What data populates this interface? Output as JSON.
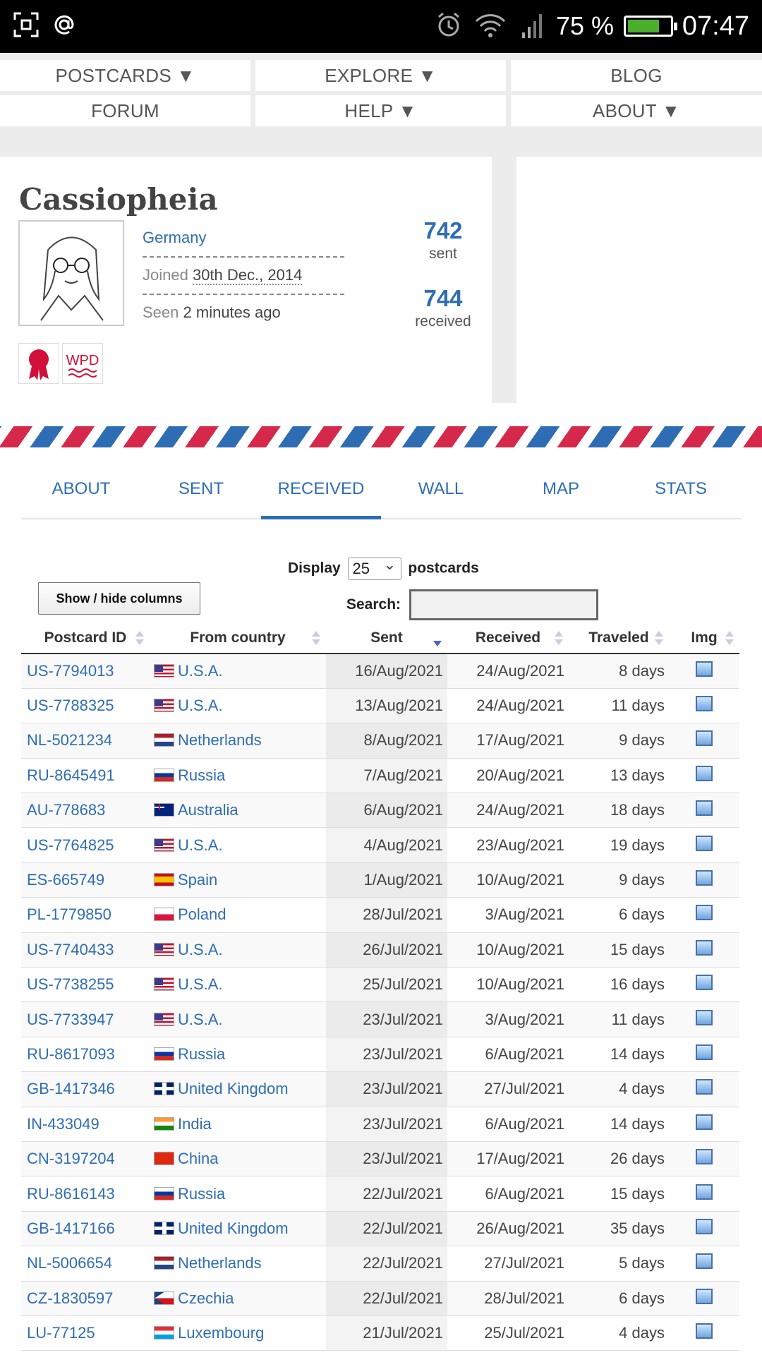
{
  "status_bar": {
    "battery_percent": "75 %",
    "battery_level": 0.75,
    "time": "07:47",
    "icons": [
      "screenshot-icon",
      "at-icon",
      "alarm-icon",
      "wifi-icon",
      "signal-icon",
      "battery-icon"
    ]
  },
  "nav": {
    "postcards": "POSTCARDS ▼",
    "explore": "EXPLORE ▼",
    "blog": "BLOG",
    "forum": "FORUM",
    "help": "HELP ▼",
    "about": "ABOUT ▼"
  },
  "profile": {
    "username": "Cassiopheia",
    "country": "Germany",
    "joined_label": "Joined",
    "joined_date": "30th Dec., 2014",
    "seen_label": "Seen",
    "seen_value": "2 minutes ago",
    "sent_count": "742",
    "sent_label": "sent",
    "received_count": "744",
    "received_label": "received",
    "badge_wpd": "WPD"
  },
  "tabs": [
    "ABOUT",
    "SENT",
    "RECEIVED",
    "WALL",
    "MAP",
    "STATS"
  ],
  "active_tab": "RECEIVED",
  "controls": {
    "display_label": "Display",
    "display_value": "25",
    "display_suffix": "postcards",
    "show_hide": "Show / hide columns",
    "search_label": "Search:",
    "search_value": ""
  },
  "table": {
    "headers": [
      "Postcard ID",
      "From country",
      "Sent",
      "Received",
      "Traveled",
      "Img"
    ],
    "rows": [
      {
        "id": "US-7794013",
        "country": "U.S.A.",
        "flag": "us",
        "sent": "16/Aug/2021",
        "received": "24/Aug/2021",
        "traveled": "8 days"
      },
      {
        "id": "US-7788325",
        "country": "U.S.A.",
        "flag": "us",
        "sent": "13/Aug/2021",
        "received": "24/Aug/2021",
        "traveled": "11 days"
      },
      {
        "id": "NL-5021234",
        "country": "Netherlands",
        "flag": "nl",
        "sent": "8/Aug/2021",
        "received": "17/Aug/2021",
        "traveled": "9 days"
      },
      {
        "id": "RU-8645491",
        "country": "Russia",
        "flag": "ru",
        "sent": "7/Aug/2021",
        "received": "20/Aug/2021",
        "traveled": "13 days"
      },
      {
        "id": "AU-778683",
        "country": "Australia",
        "flag": "au",
        "sent": "6/Aug/2021",
        "received": "24/Aug/2021",
        "traveled": "18 days"
      },
      {
        "id": "US-7764825",
        "country": "U.S.A.",
        "flag": "us",
        "sent": "4/Aug/2021",
        "received": "23/Aug/2021",
        "traveled": "19 days"
      },
      {
        "id": "ES-665749",
        "country": "Spain",
        "flag": "es",
        "sent": "1/Aug/2021",
        "received": "10/Aug/2021",
        "traveled": "9 days"
      },
      {
        "id": "PL-1779850",
        "country": "Poland",
        "flag": "pl",
        "sent": "28/Jul/2021",
        "received": "3/Aug/2021",
        "traveled": "6 days"
      },
      {
        "id": "US-7740433",
        "country": "U.S.A.",
        "flag": "us",
        "sent": "26/Jul/2021",
        "received": "10/Aug/2021",
        "traveled": "15 days"
      },
      {
        "id": "US-7738255",
        "country": "U.S.A.",
        "flag": "us",
        "sent": "25/Jul/2021",
        "received": "10/Aug/2021",
        "traveled": "16 days"
      },
      {
        "id": "US-7733947",
        "country": "U.S.A.",
        "flag": "us",
        "sent": "23/Jul/2021",
        "received": "3/Aug/2021",
        "traveled": "11 days"
      },
      {
        "id": "RU-8617093",
        "country": "Russia",
        "flag": "ru",
        "sent": "23/Jul/2021",
        "received": "6/Aug/2021",
        "traveled": "14 days"
      },
      {
        "id": "GB-1417346",
        "country": "United Kingdom",
        "flag": "gb",
        "sent": "23/Jul/2021",
        "received": "27/Jul/2021",
        "traveled": "4 days"
      },
      {
        "id": "IN-433049",
        "country": "India",
        "flag": "in",
        "sent": "23/Jul/2021",
        "received": "6/Aug/2021",
        "traveled": "14 days"
      },
      {
        "id": "CN-3197204",
        "country": "China",
        "flag": "cn",
        "sent": "23/Jul/2021",
        "received": "17/Aug/2021",
        "traveled": "26 days"
      },
      {
        "id": "RU-8616143",
        "country": "Russia",
        "flag": "ru",
        "sent": "22/Jul/2021",
        "received": "6/Aug/2021",
        "traveled": "15 days"
      },
      {
        "id": "GB-1417166",
        "country": "United Kingdom",
        "flag": "gb",
        "sent": "22/Jul/2021",
        "received": "26/Aug/2021",
        "traveled": "35 days"
      },
      {
        "id": "NL-5006654",
        "country": "Netherlands",
        "flag": "nl",
        "sent": "22/Jul/2021",
        "received": "27/Jul/2021",
        "traveled": "5 days"
      },
      {
        "id": "CZ-1830597",
        "country": "Czechia",
        "flag": "cz",
        "sent": "22/Jul/2021",
        "received": "28/Jul/2021",
        "traveled": "6 days"
      },
      {
        "id": "LU-77125",
        "country": "Luxembourg",
        "flag": "lu",
        "sent": "21/Jul/2021",
        "received": "25/Jul/2021",
        "traveled": "4 days"
      }
    ]
  },
  "colors": {
    "link": "#2e6db4",
    "airmail_red": "#d6284a",
    "airmail_blue": "#2e6db4",
    "badge_red": "#d0103a"
  }
}
